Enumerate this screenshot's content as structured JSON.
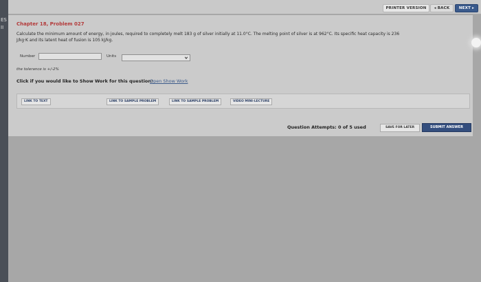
{
  "sidebar": {
    "label1": "ES",
    "label2": "II"
  },
  "topbar": {
    "printer_version": "PRINTER VERSION",
    "back": "◂ BACK",
    "next": "NEXT ▸"
  },
  "problem": {
    "title": "Chapter 18, Problem 027",
    "text_line1": "Calculate the minimum amount of energy, in joules, required to completely melt 183 g of silver initially at 11.0°C. The melting point of silver is at 962°C. Its specific heat capacity is 236",
    "text_line2": "J/kg·K and its latent heat of fusion is 105 kJ/kg."
  },
  "answer": {
    "number_label": "Number",
    "number_value": "",
    "units_label": "Units",
    "units_selected": ""
  },
  "tolerance": "the tolerance is +/-2%",
  "show_work": {
    "question": "Click if you would like to Show Work for this question:",
    "link": "Open Show Work"
  },
  "links": {
    "link_to_text": "LINK TO TEXT",
    "sample1": "LINK TO SAMPLE PROBLEM",
    "sample2": "LINK TO SAMPLE PROBLEM",
    "video": "VIDEO MINI-LECTURE"
  },
  "footer": {
    "attempts": "Question Attempts: 0 of 5 used",
    "save": "SAVE FOR LATER",
    "submit": "SUBMIT ANSWER"
  },
  "colors": {
    "title": "#b33a3a",
    "link": "#3b5a8a",
    "primary_button": "#344e7e"
  }
}
